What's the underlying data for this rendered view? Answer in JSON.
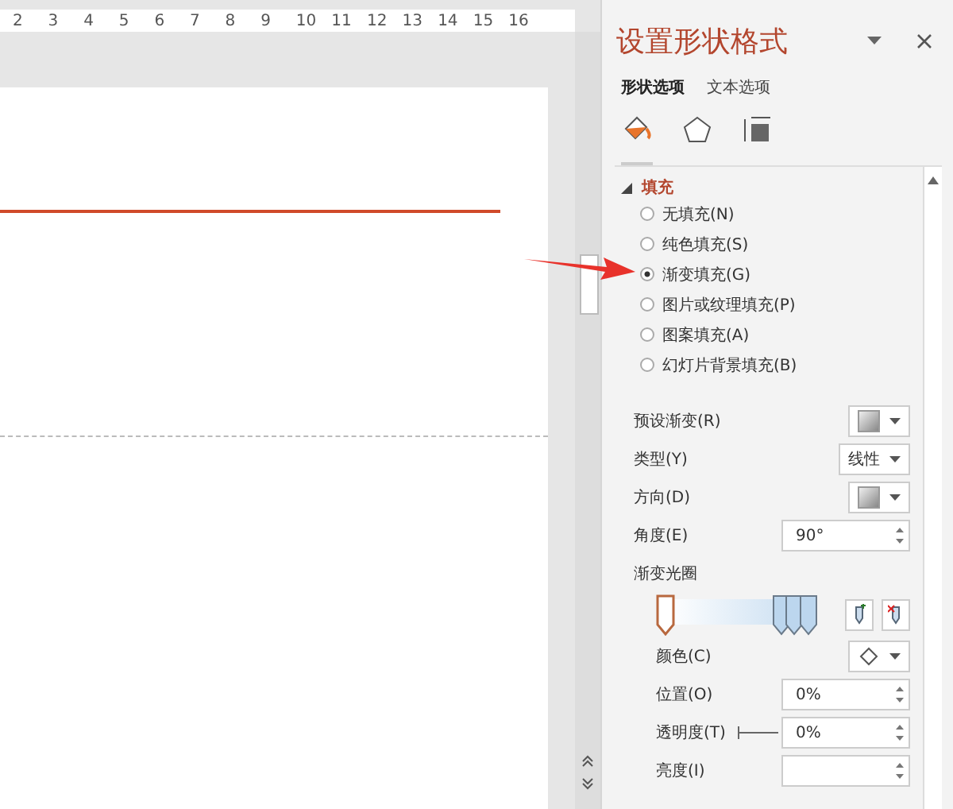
{
  "ruler": {
    "ticks": [
      "2",
      "3",
      "4",
      "5",
      "6",
      "7",
      "8",
      "9",
      "10",
      "11",
      "12",
      "13",
      "14",
      "15",
      "16"
    ]
  },
  "pane": {
    "title": "设置形状格式",
    "tabs": [
      {
        "label": "形状选项",
        "selected": true
      },
      {
        "label": "文本选项",
        "selected": false
      }
    ],
    "icon_tabs": [
      {
        "kind": "fill",
        "selected": true
      },
      {
        "kind": "effects",
        "selected": false
      },
      {
        "kind": "size",
        "selected": false
      }
    ],
    "section": {
      "title": "填充",
      "expanded": true
    },
    "fill_options": [
      {
        "label": "无填充(N)",
        "selected": false
      },
      {
        "label": "纯色填充(S)",
        "selected": false
      },
      {
        "label": "渐变填充(G)",
        "selected": true
      },
      {
        "label": "图片或纹理填充(P)",
        "selected": false
      },
      {
        "label": "图案填充(A)",
        "selected": false
      },
      {
        "label": "幻灯片背景填充(B)",
        "selected": false
      }
    ],
    "rows": [
      {
        "kind": "swatch",
        "label": "预设渐变(R)"
      },
      {
        "kind": "dropdown",
        "label": "类型(Y)",
        "value": "线性"
      },
      {
        "kind": "swatch",
        "label": "方向(D)"
      },
      {
        "kind": "spin",
        "label": "角度(E)",
        "value": "90°"
      },
      {
        "kind": "heading",
        "label": "渐变光圈"
      },
      {
        "kind": "stops",
        "stops": [
          {
            "level": 0.0,
            "selected": true
          },
          {
            "level": 0.78,
            "selected": false
          },
          {
            "level": 0.86,
            "selected": false
          },
          {
            "level": 0.96,
            "selected": false
          }
        ]
      },
      {
        "kind": "color",
        "label": "颜色(C)"
      },
      {
        "kind": "spin",
        "label": "位置(O)",
        "value": "0%"
      },
      {
        "kind": "spin",
        "label": "透明度(T)",
        "value": "0%",
        "slider": true
      },
      {
        "kind": "spin",
        "label": "亮度(I)"
      }
    ]
  }
}
